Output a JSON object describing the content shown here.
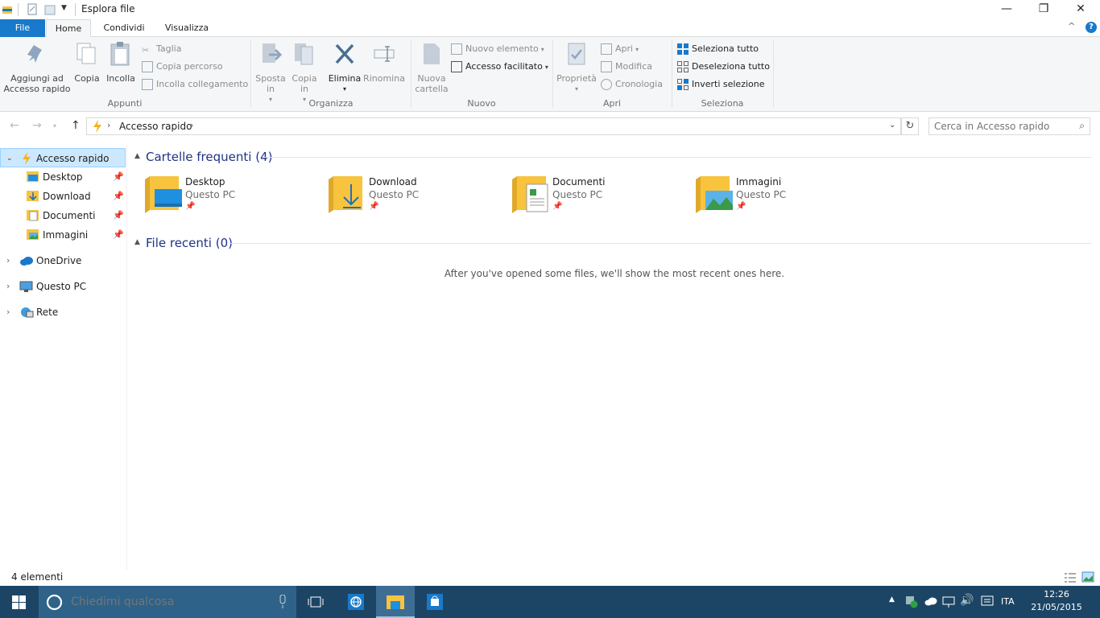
{
  "window": {
    "title": "Esplora file",
    "minimize_glyph": "—",
    "maximize_glyph": "❐",
    "close_glyph": "✕",
    "help_glyph": "?",
    "collapse_glyph": "^"
  },
  "ribbon_tabs": [
    {
      "label": "File"
    },
    {
      "label": "Home"
    },
    {
      "label": "Condividi"
    },
    {
      "label": "Visualizza"
    }
  ],
  "ribbon": {
    "appunti": {
      "group_label": "Appunti",
      "pin_label": "Aggiungi ad Accesso rapido",
      "copy_label": "Copia",
      "paste_label": "Incolla",
      "cut_label": "Taglia",
      "copy_path_label": "Copia percorso",
      "paste_shortcut_label": "Incolla collegamento"
    },
    "organizza": {
      "group_label": "Organizza",
      "move_label": "Sposta in",
      "copyto_label": "Copia in",
      "delete_label": "Elimina",
      "rename_label": "Rinomina"
    },
    "nuovo": {
      "group_label": "Nuovo",
      "new_folder_label": "Nuova cartella",
      "new_item_label": "Nuovo elemento",
      "easy_access_label": "Accesso facilitato"
    },
    "apri": {
      "group_label": "Apri",
      "properties_label": "Proprietà",
      "open_label": "Apri",
      "edit_label": "Modifica",
      "history_label": "Cronologia"
    },
    "seleziona": {
      "group_label": "Seleziona",
      "select_all_label": "Seleziona tutto",
      "select_none_label": "Deseleziona tutto",
      "invert_label": "Inverti selezione"
    }
  },
  "address_bar": {
    "path": [
      "Accesso rapido"
    ],
    "search_placeholder": "Cerca in Accesso rapido"
  },
  "nav_pane": {
    "quick_access": "Accesso rapido",
    "pinned": [
      {
        "label": "Desktop"
      },
      {
        "label": "Download"
      },
      {
        "label": "Documenti"
      },
      {
        "label": "Immagini"
      }
    ],
    "onedrive": "OneDrive",
    "this_pc": "Questo PC",
    "network": "Rete"
  },
  "content": {
    "frequent_header": "Cartelle frequenti (4)",
    "recent_header": "File recenti (0)",
    "folders": [
      {
        "name": "Desktop",
        "location": "Questo PC"
      },
      {
        "name": "Download",
        "location": "Questo PC"
      },
      {
        "name": "Documenti",
        "location": "Questo PC"
      },
      {
        "name": "Immagini",
        "location": "Questo PC"
      }
    ],
    "empty_message": "After you've opened some files, we'll show the most recent ones here."
  },
  "status_bar": {
    "count": "4 elementi"
  },
  "taskbar": {
    "search_placeholder": "Chiedimi qualcosa",
    "language": "ITA",
    "time": "12:26",
    "date": "21/05/2015"
  },
  "colors": {
    "accent": "#1979ca",
    "taskbar": "#1c4565",
    "selection": "#cce8ff",
    "folder": "#f8c33d",
    "section_header": "#1e3287"
  }
}
